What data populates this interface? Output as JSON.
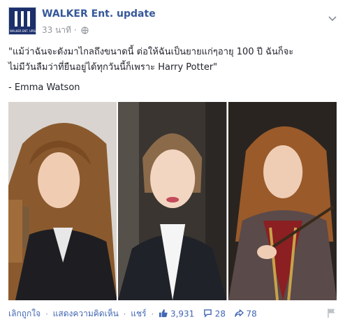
{
  "page": {
    "name": "WALKER Ent. update",
    "avatar_caption": "WALKER ENT. UPDATE",
    "timestamp": "33 นาที",
    "audience": "globe-icon"
  },
  "post": {
    "quote_line1": "\"แม้ว่าฉันจะดังมาไกลถึงขนาดนี้ ต่อให้ฉันเป็นยายแก่ๆอายุ 100 ปี ฉันก็จะ",
    "quote_line2": "ไม่มีวันลืมว่าที่ยืนอยู่ได้ทุกวันนี้ก็เพราะ Harry Potter\"",
    "attribution": "- Emma Watson"
  },
  "actions": {
    "unlike": "เลิกถูกใจ",
    "comment": "แสดงความคิดเห็น",
    "share": "แชร์",
    "likes": "3,931",
    "comments": "28",
    "shares": "78"
  },
  "colors": {
    "link": "#4267b2",
    "name": "#365899",
    "meta": "#90949c",
    "brand": "#1c2f6b"
  }
}
